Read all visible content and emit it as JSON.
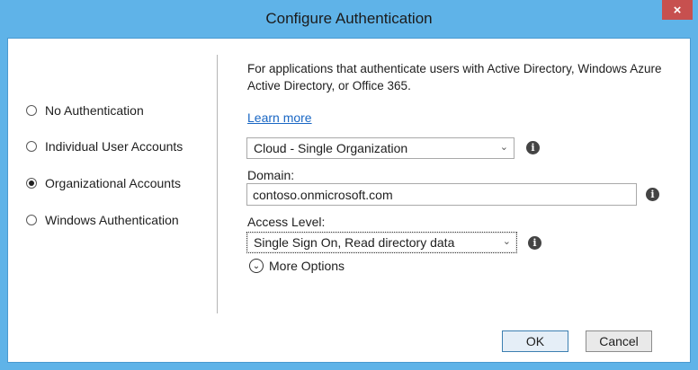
{
  "window": {
    "title": "Configure Authentication",
    "close_label": "×"
  },
  "auth_options": [
    {
      "label": "No Authentication",
      "checked": false
    },
    {
      "label": "Individual User Accounts",
      "checked": false
    },
    {
      "label": "Organizational Accounts",
      "checked": true
    },
    {
      "label": "Windows Authentication",
      "checked": false
    }
  ],
  "description": "For applications that authenticate users with Active Directory, Windows Azure Active Directory, or Office 365.",
  "learn_more": "Learn more",
  "org_type": {
    "value": "Cloud - Single Organization"
  },
  "domain": {
    "label": "Domain:",
    "value": "contoso.onmicrosoft.com"
  },
  "access_level": {
    "label": "Access Level:",
    "value": "Single Sign On, Read directory data"
  },
  "more_options": "More Options",
  "buttons": {
    "ok": "OK",
    "cancel": "Cancel"
  },
  "icons": {
    "info": "info-icon",
    "chevron": "chevron-down-icon",
    "expand": "expand-circle-icon"
  },
  "colors": {
    "titlebar": "#5fb3e8",
    "close": "#c7504f",
    "link": "#1a67c4"
  }
}
